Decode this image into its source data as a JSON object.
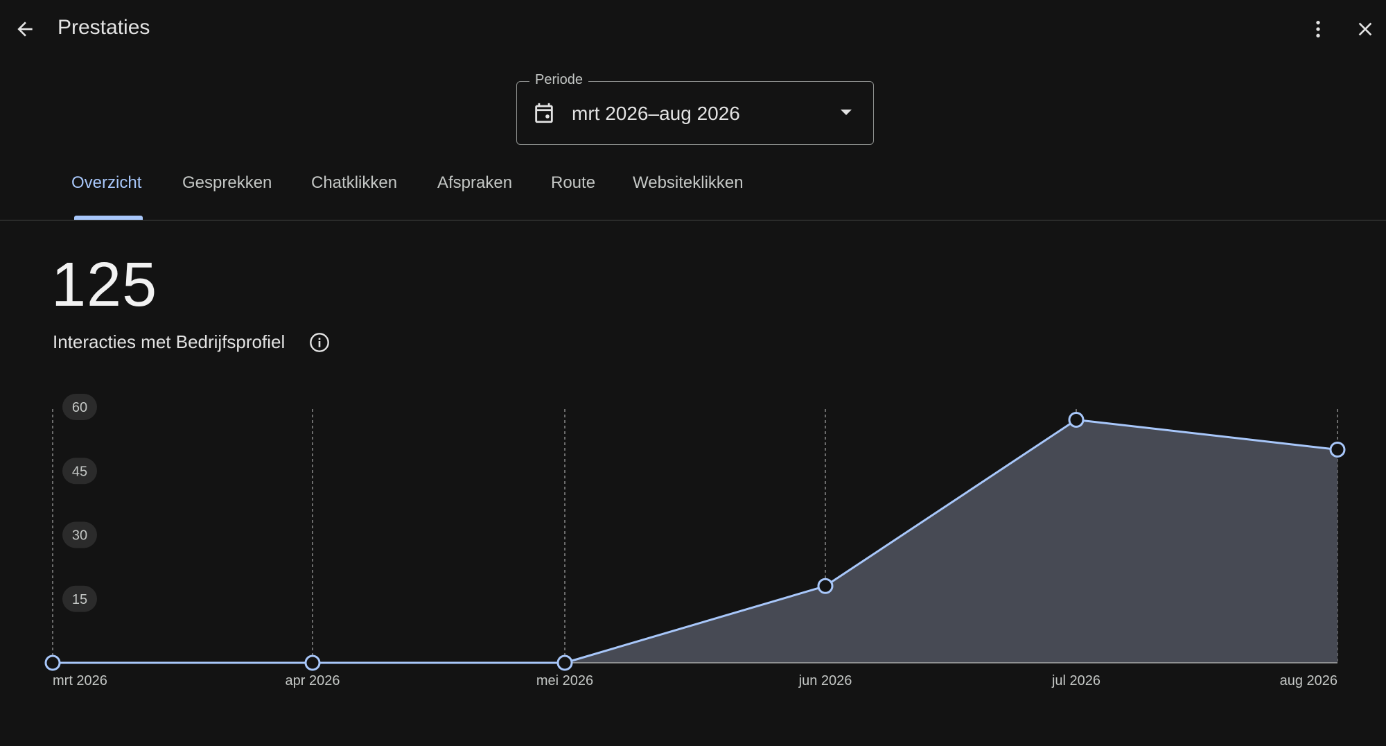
{
  "header": {
    "title": "Prestaties",
    "back_icon": "arrow-left-icon",
    "more_icon": "more-vertical-icon",
    "close_icon": "close-icon"
  },
  "period": {
    "label": "Periode",
    "value": "mrt 2026–aug 2026",
    "icon": "calendar-icon"
  },
  "tabs": [
    {
      "label": "Overzicht",
      "active": true
    },
    {
      "label": "Gesprekken",
      "active": false
    },
    {
      "label": "Chatklikken",
      "active": false
    },
    {
      "label": "Afspraken",
      "active": false
    },
    {
      "label": "Route",
      "active": false
    },
    {
      "label": "Websiteklikken",
      "active": false
    }
  ],
  "metric": {
    "value": "125",
    "label": "Interacties met Bedrijfsprofiel"
  },
  "colors": {
    "background": "#131313",
    "accent": "#a8c7fa",
    "area_fill": "#474a54"
  },
  "chart_data": {
    "type": "area",
    "categories": [
      "mrt 2026",
      "apr 2026",
      "mei 2026",
      "jun 2026",
      "jul 2026",
      "aug 2026"
    ],
    "values": [
      0,
      0,
      0,
      18,
      57,
      50
    ],
    "yticks": [
      15,
      30,
      45,
      60
    ],
    "ylim": [
      0,
      60
    ],
    "grid": "vertical-dashed"
  }
}
